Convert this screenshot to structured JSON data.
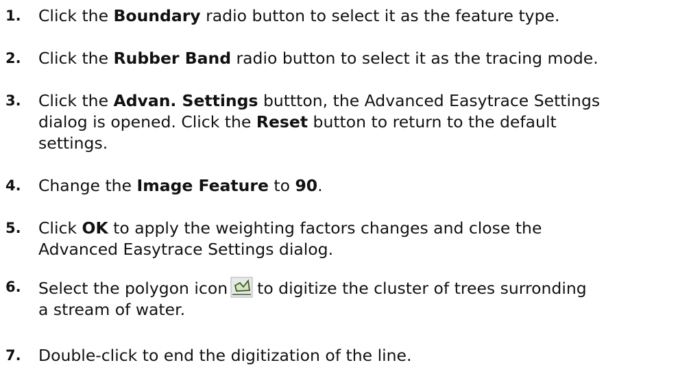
{
  "steps": [
    {
      "number": "1.",
      "pre": "Click the ",
      "bold": "Boundary",
      "post": " radio button to select it as the feature type."
    },
    {
      "number": "2.",
      "pre": "Click the ",
      "bold": "Rubber Band",
      "post": " radio button to select it as the tracing mode."
    },
    {
      "number": "3.",
      "pre": "Click the ",
      "bold": "Advan. Settings",
      "mid1": " buttton, the Advanced Easytrace Settings",
      "line2": "dialog is opened. Click the ",
      "bold2": "Reset",
      "post2": " button to return to the default",
      "line3": "settings."
    },
    {
      "number": "4.",
      "pre": "Change the ",
      "bold": "Image Feature",
      "mid": " to ",
      "bold2": "90",
      "post": "."
    },
    {
      "number": "5.",
      "pre": "Click ",
      "bold": "OK",
      "post": " to apply the weighting factors changes and close the",
      "line2": "Advanced Easytrace Settings dialog."
    },
    {
      "number": "6.",
      "pre": "Select the polygon icon",
      "icon": "polygon-tool-icon",
      "post": "to digitize the cluster of trees surronding",
      "line2": "a stream of water."
    },
    {
      "number": "7.",
      "pre": "Double-click to end the digitization of the line."
    }
  ],
  "colors": {
    "text": "#111111",
    "icon_fill": "#d8e6c0",
    "icon_stroke": "#3a5a2a"
  }
}
